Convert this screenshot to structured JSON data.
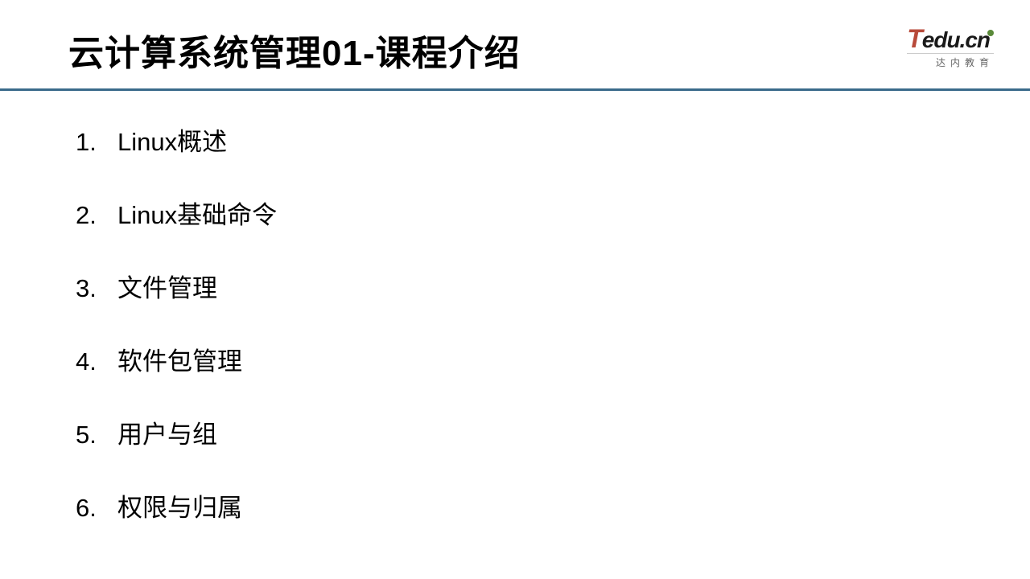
{
  "header": {
    "title": "云计算系统管理01-课程介绍"
  },
  "logo": {
    "brand_t": "T",
    "brand_rest": "edu.cn",
    "subtitle": "达内教育"
  },
  "outline": {
    "items": [
      {
        "num": "1.",
        "text": "Linux概述"
      },
      {
        "num": "2.",
        "text": "Linux基础命令"
      },
      {
        "num": "3.",
        "text": "文件管理"
      },
      {
        "num": "4.",
        "text": "软件包管理"
      },
      {
        "num": "5.",
        "text": "用户与组"
      },
      {
        "num": "6.",
        "text": "权限与归属"
      }
    ]
  }
}
